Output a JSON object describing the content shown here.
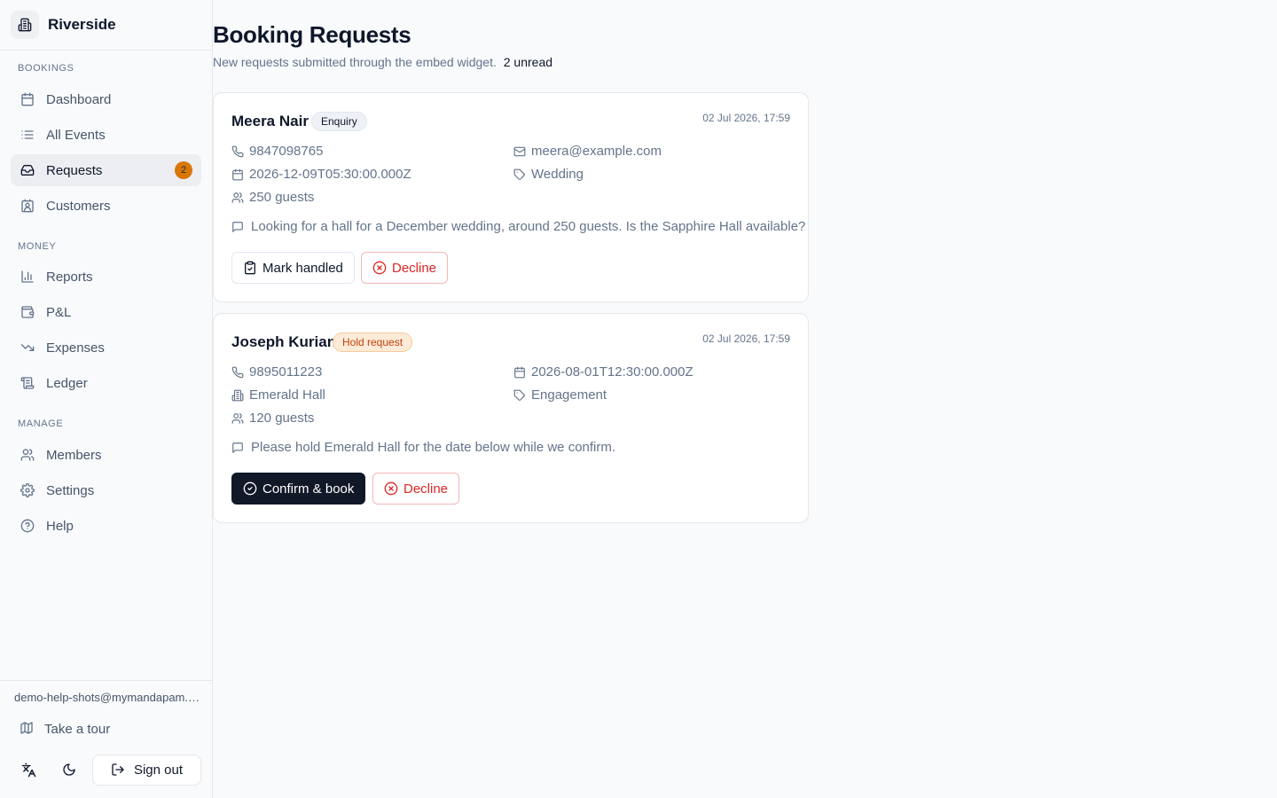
{
  "brand": {
    "name": "Riverside",
    "logo_icon": "building-icon"
  },
  "sidebar": {
    "sections": [
      {
        "label": "BOOKINGS"
      },
      {
        "label": "MONEY"
      },
      {
        "label": "MANAGE"
      }
    ],
    "items": [
      {
        "label": "Dashboard",
        "icon": "calendar-icon"
      },
      {
        "label": "All Events",
        "icon": "list-icon"
      },
      {
        "label": "Requests",
        "icon": "inbox-icon",
        "badge": "2",
        "active": true
      },
      {
        "label": "Customers",
        "icon": "contact-icon"
      },
      {
        "label": "Reports",
        "icon": "bar-chart-icon"
      },
      {
        "label": "P&L",
        "icon": "wallet-icon"
      },
      {
        "label": "Expenses",
        "icon": "trending-down-icon"
      },
      {
        "label": "Ledger",
        "icon": "scroll-icon"
      },
      {
        "label": "Members",
        "icon": "users-icon"
      },
      {
        "label": "Settings",
        "icon": "gear-icon"
      },
      {
        "label": "Help",
        "icon": "help-circle-icon"
      }
    ],
    "footer": {
      "email": "demo-help-shots@mymandapam.com",
      "tour_label": "Take a tour",
      "signout_label": "Sign out"
    }
  },
  "header": {
    "title": "Booking Requests",
    "subtitle": "New requests submitted through the embed widget.",
    "unread": "2 unread"
  },
  "requests": [
    {
      "name": "Meera Nair",
      "tag": "Enquiry",
      "time": "02 Jul 2026, 17:59",
      "phone": "9847098765",
      "email": "meera@example.com",
      "date": "2026-12-09T05:30:00.000Z",
      "event_type": "Wedding",
      "guests": "250 guests",
      "message": "Looking for a hall for a December wedding, around 250 guests. Is the Sapphire Hall available?",
      "actions": {
        "primary": "Mark handled",
        "decline": "Decline"
      }
    },
    {
      "name": "Joseph Kurian",
      "tag": "Hold request",
      "time": "02 Jul 2026, 17:59",
      "phone": "9895011223",
      "date": "2026-08-01T12:30:00.000Z",
      "hall": "Emerald Hall",
      "event_type": "Engagement",
      "guests": "120 guests",
      "message": "Please hold Emerald Hall for the date below while we confirm.",
      "actions": {
        "primary": "Confirm & book",
        "decline": "Decline"
      }
    }
  ],
  "colors": {
    "accent_badge": "#d97706",
    "danger": "#dc2626",
    "primary_button": "#111827",
    "hold_pill_bg": "#fdebd8"
  }
}
